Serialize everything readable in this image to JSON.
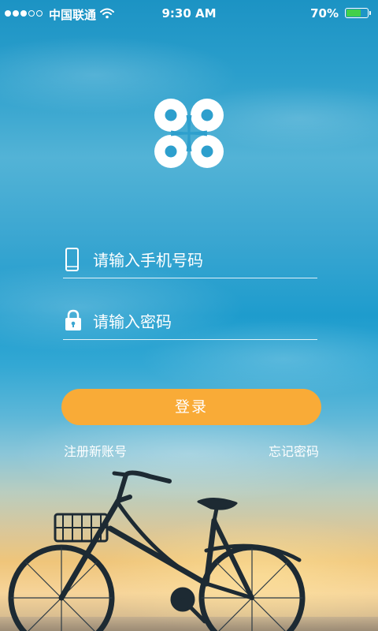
{
  "status_bar": {
    "signal_filled": 3,
    "signal_total": 5,
    "carrier": "中国联通",
    "wifi_icon": "wifi-icon",
    "time": "9:30 AM",
    "battery_percent": "70%",
    "battery_level": 0.7,
    "battery_color": "#43d04a"
  },
  "logo": {
    "icon": "app-logo-icon"
  },
  "form": {
    "phone": {
      "icon": "phone-icon",
      "placeholder": "请输入手机号码",
      "value": ""
    },
    "password": {
      "icon": "lock-icon",
      "placeholder": "请输入密码",
      "value": ""
    },
    "login_label": "登录",
    "login_color": "#f9ab37",
    "register_label": "注册新账号",
    "forgot_label": "忘记密码"
  }
}
